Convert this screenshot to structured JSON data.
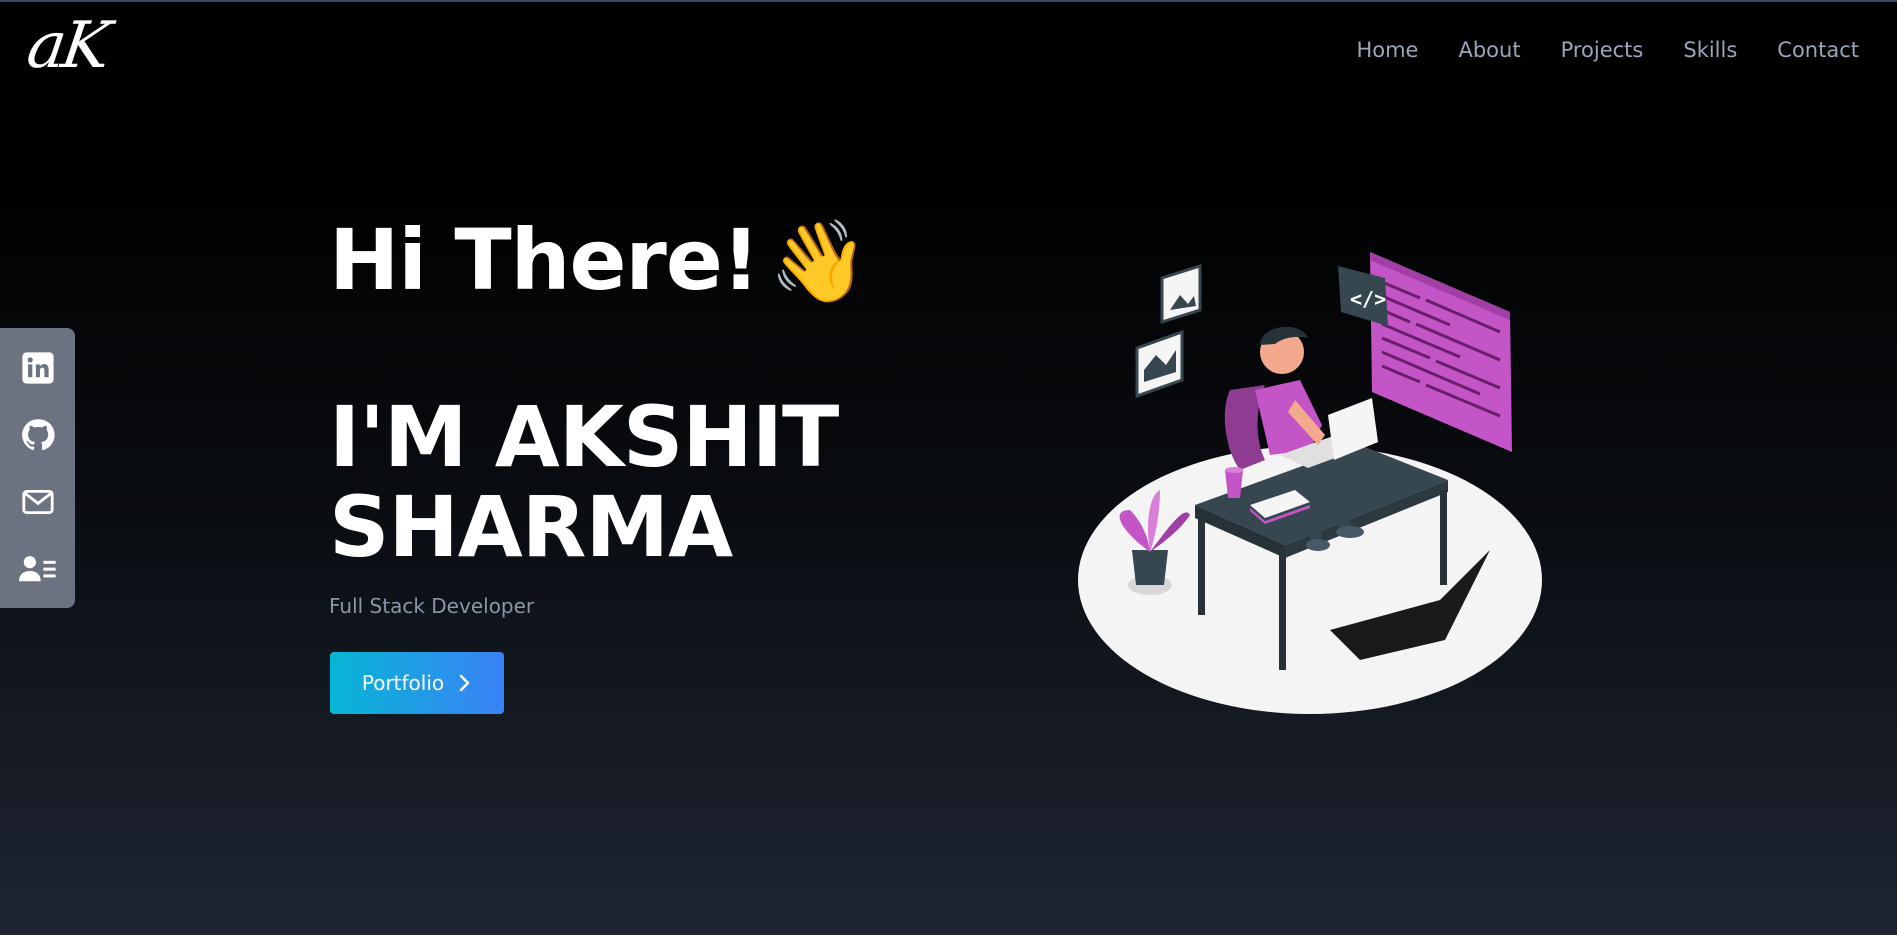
{
  "header": {
    "logo_text": "aK",
    "nav": [
      {
        "label": "Home"
      },
      {
        "label": "About"
      },
      {
        "label": "Projects"
      },
      {
        "label": "Skills"
      },
      {
        "label": "Contact"
      }
    ]
  },
  "social": {
    "icons": [
      "linkedin-icon",
      "github-icon",
      "mail-icon",
      "contact-card-icon"
    ]
  },
  "hero": {
    "greeting": "Hi There!",
    "wave_emoji": "👋",
    "name_line1": "I'M AKSHIT",
    "name_line2": "SHARMA",
    "role": "Full Stack Developer",
    "button_label": "Portfolio"
  },
  "colors": {
    "accent_start": "#06b6d4",
    "accent_end": "#3b82f6",
    "sidebar_bg": "#6b7280",
    "nav_text": "#9aa6ba",
    "illustration_accent": "#c455c6"
  }
}
